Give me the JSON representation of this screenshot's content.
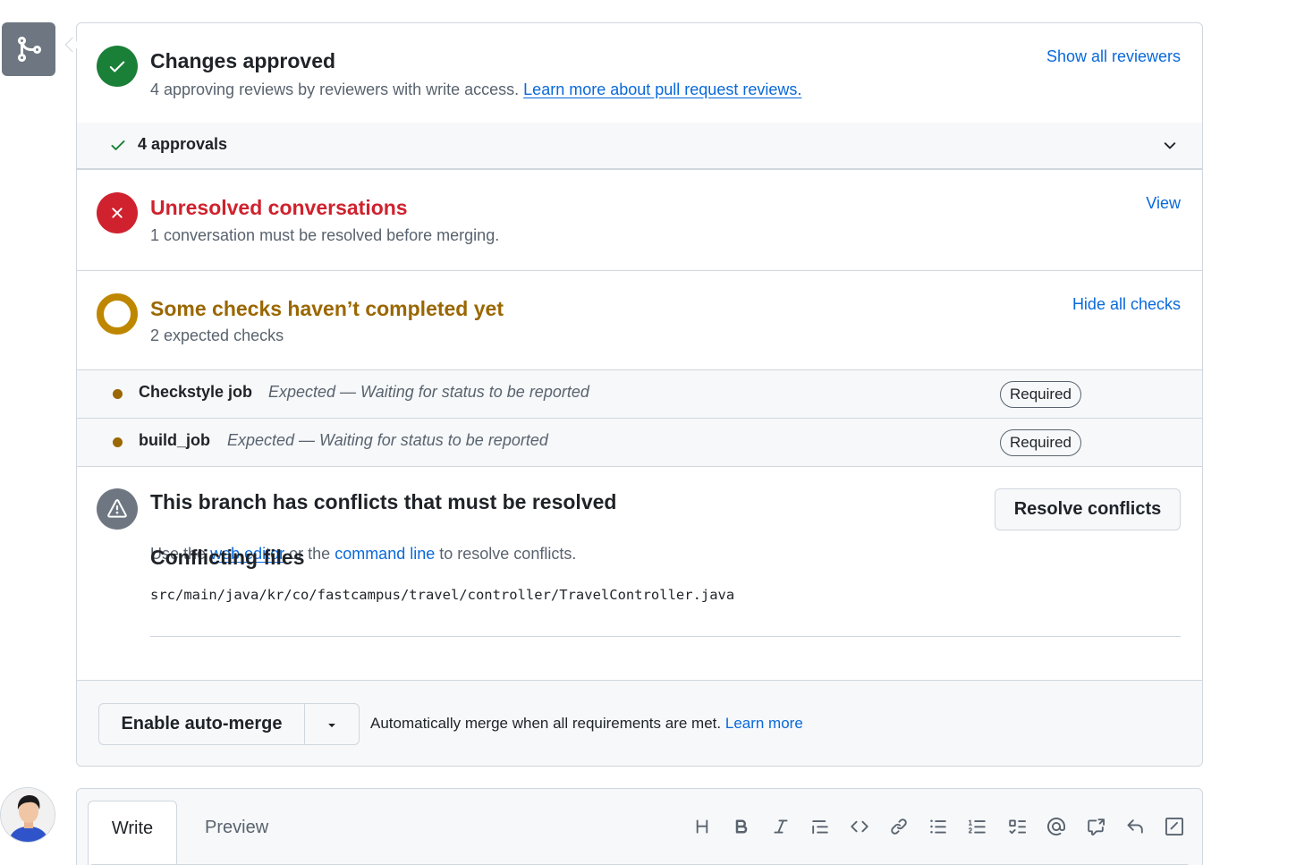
{
  "review": {
    "title": "Changes approved",
    "subtitle": "4 approving reviews by reviewers with write access.",
    "learn_link": "Learn more about pull request reviews.",
    "show_reviewers": "Show all reviewers",
    "approvals_label": "4 approvals"
  },
  "conversations": {
    "title": "Unresolved conversations",
    "subtitle": "1 conversation must be resolved before merging.",
    "view_link": "View"
  },
  "checks": {
    "title": "Some checks haven’t completed yet",
    "subtitle": "2 expected checks",
    "hide_link": "Hide all checks",
    "items": [
      {
        "name": "Checkstyle job",
        "status": "Expected — Waiting for status to be reported",
        "badge": "Required"
      },
      {
        "name": "build_job",
        "status": "Expected — Waiting for status to be reported",
        "badge": "Required"
      }
    ]
  },
  "conflicts": {
    "title": "This branch has conflicts that must be resolved",
    "text_use": "Use the",
    "web_editor": "web editor",
    "text_or": "or the",
    "command_line": "command line",
    "text_end": "to resolve conflicts.",
    "resolve_button": "Resolve conflicts",
    "heading": "Conflicting files",
    "file": "src/main/java/kr/co/fastcampus/travel/controller/TravelController.java"
  },
  "merge": {
    "auto_merge_button": "Enable auto-merge",
    "description": "Automatically merge when all requirements are met.",
    "learn_more": "Learn more"
  },
  "comment": {
    "tab_write": "Write",
    "tab_preview": "Preview"
  },
  "colors": {
    "success": "#1a7f37",
    "danger": "#cf222e",
    "attention": "#9a6700",
    "accent": "#0969da",
    "neutral": "#6e7781"
  },
  "icons": [
    "git-merge-icon",
    "check-circle-icon",
    "check-icon",
    "chevron-down-icon",
    "x-circle-icon",
    "pending-ring-icon",
    "alert-icon",
    "triangle-down-icon",
    "heading-icon",
    "bold-icon",
    "italic-icon",
    "quote-icon",
    "code-icon",
    "link-icon",
    "unordered-list-icon",
    "ordered-list-icon",
    "task-list-icon",
    "mention-icon",
    "cross-reference-icon",
    "reply-icon",
    "slash-command-icon"
  ]
}
